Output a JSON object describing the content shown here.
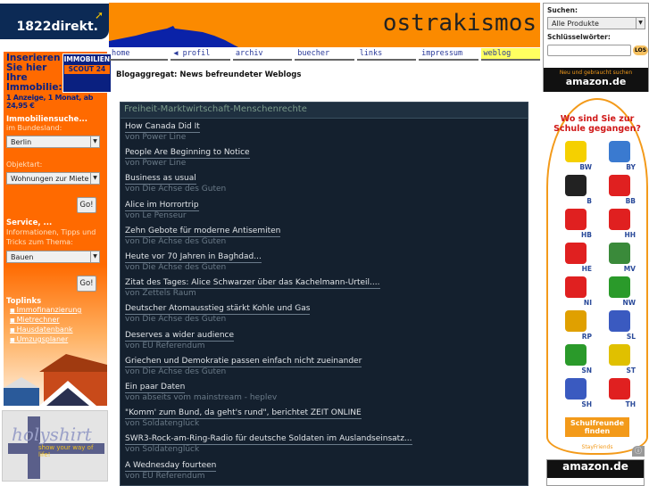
{
  "left": {
    "logo": "1822direkt.",
    "ad": {
      "line1": "Inserieren Sie hier Ihre Immobilie:",
      "scout": [
        "IMMOBILIEN",
        "SCOUT 24"
      ],
      "price": "1 Anzeige, 1 Monat, ab 24,95 €",
      "search_title": "Immobiliensuche...",
      "state_label": "im Bundesland:",
      "state_value": "Berlin",
      "type_label": "Objektart:",
      "type_value": "Wohnungen zur Miete",
      "go": "Go!",
      "service_title": "Service, ...",
      "service_text": "Informationen, Tipps und Tricks zum Thema:",
      "service_value": "Bauen",
      "toplinks_title": "Toplinks",
      "toplinks": [
        "Immofinanzierung",
        "Mietrechner",
        "Hausdatenbank",
        "Umzugsplaner"
      ]
    },
    "holyshirt": {
      "logo": "holyshirt",
      "tagline": "show your way of life!"
    }
  },
  "header": {
    "title": "ostrakismos",
    "nav": [
      "home",
      "profil",
      "archiv",
      "buecher",
      "links",
      "impressum",
      "weblog"
    ],
    "active": "weblog"
  },
  "page_heading": "Blogaggregat: News befreundeter Weblogs",
  "feed": {
    "title": "Freiheit-Marktwirtschaft-Menschenrechte",
    "items": [
      {
        "title": "How Canada Did It",
        "by": "von Power Line"
      },
      {
        "title": "People Are Beginning to Notice",
        "by": "von Power Line"
      },
      {
        "title": "Business as usual",
        "by": "von Die Achse des Guten"
      },
      {
        "title": "Alice im Horrortrip",
        "by": "von Le Penseur"
      },
      {
        "title": "Zehn Gebote für moderne Antisemiten",
        "by": "von Die Achse des Guten"
      },
      {
        "title": "Heute vor 70 Jahren in Baghdad...",
        "by": "von Die Achse des Guten"
      },
      {
        "title": "Zitat des Tages: Alice Schwarzer über das Kachelmann-Urteil....",
        "by": "von Zettels Raum"
      },
      {
        "title": "Deutscher Atomausstieg stärkt Kohle und Gas",
        "by": "von Die Achse des Guten"
      },
      {
        "title": "Deserves a wider audience",
        "by": "von EU Referendum"
      },
      {
        "title": "Griechen und Demokratie passen einfach nicht zueinander",
        "by": "von Die Achse des Guten"
      },
      {
        "title": "Ein paar Daten",
        "by": "von abseits vom mainstream - heplev"
      },
      {
        "title": "\"Komm' zum Bund, da geht's rund\", berichtet ZEIT ONLINE",
        "by": "von Soldatenglück"
      },
      {
        "title": "SWR3-Rock-am-Ring-Radio für deutsche Soldaten im Auslandseinsatz...",
        "by": "von Soldatenglück"
      },
      {
        "title": "A Wednesday fourteen",
        "by": "von EU Referendum"
      }
    ]
  },
  "amazon": {
    "search_label": "Suchen:",
    "category": "Alle Produkte",
    "keywords_label": "Schlüsselwörter:",
    "keywords_value": "",
    "go": "LOS",
    "tagline": "Neu und gebraucht suchen",
    "logo": "amazon.de"
  },
  "stayfriends": {
    "question": "Wo sind Sie zur Schule gegangen?",
    "states": [
      "BW",
      "BY",
      "B",
      "BB",
      "HB",
      "HH",
      "HE",
      "MV",
      "NI",
      "NW",
      "RP",
      "SL",
      "SN",
      "ST",
      "SH",
      "TH"
    ],
    "state_colors": [
      "#f5d000",
      "#3a7ad0",
      "#222222",
      "#e02020",
      "#e02020",
      "#e02020",
      "#e02020",
      "#3a8a3a",
      "#e02020",
      "#2a9a2a",
      "#e0a000",
      "#3a5ac0",
      "#2a9a2a",
      "#e0c000",
      "#3a5ac0",
      "#e02020"
    ],
    "button": "Schulfreunde finden",
    "logo": "StayFriends"
  },
  "amazon2": {
    "logo": "amazon.de"
  }
}
